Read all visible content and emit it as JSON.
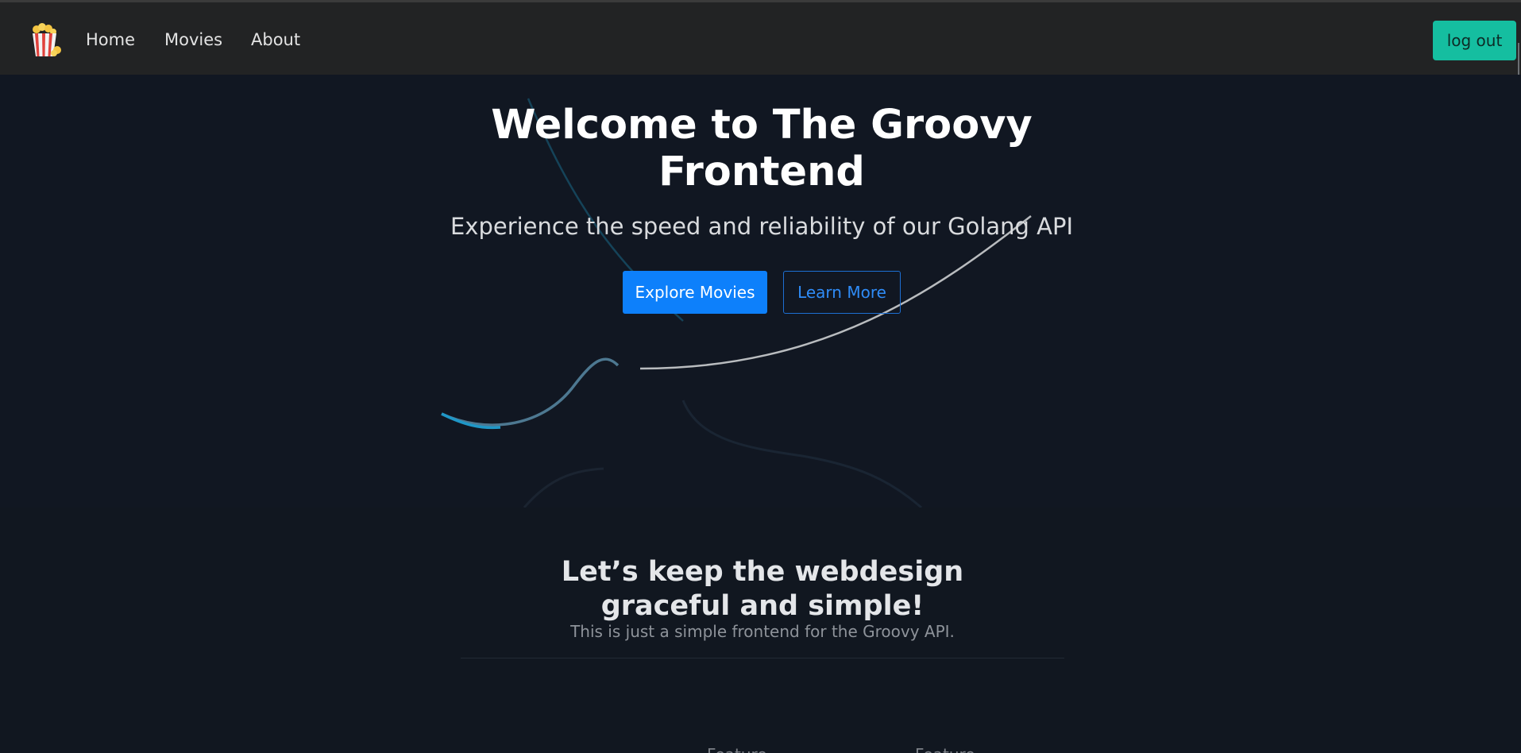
{
  "nav": {
    "logo_icon": "popcorn-icon",
    "links": [
      "Home",
      "Movies",
      "About"
    ],
    "logout_label": "log out"
  },
  "hero": {
    "title": "Welcome to The Groovy Frontend",
    "subtitle": "Experience the speed and reliability of our Golang API",
    "primary_button": "Explore Movies",
    "secondary_button": "Learn More"
  },
  "section": {
    "title": "Let’s keep the webdesign graceful and simple!",
    "text": "This is just a simple frontend for the Groovy API."
  },
  "colors": {
    "navbar": "#222324",
    "background": "#111720",
    "logout_button": "#15bea0",
    "primary_button": "#0d80fb",
    "outline_button": "#2f8cf8"
  }
}
